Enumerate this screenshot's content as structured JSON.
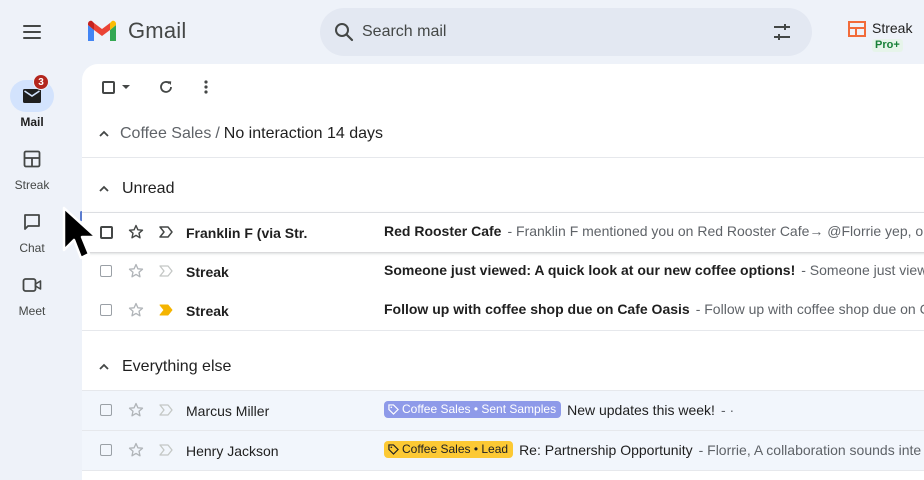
{
  "app": {
    "name": "Gmail"
  },
  "search": {
    "placeholder": "Search mail"
  },
  "streak": {
    "name": "Streak",
    "plan": "Pro+"
  },
  "rail": [
    {
      "label": "Mail",
      "icon": "mail-icon",
      "badge": "3",
      "active": true
    },
    {
      "label": "Streak",
      "icon": "streak-board-icon"
    },
    {
      "label": "Chat",
      "icon": "chat-icon"
    },
    {
      "label": "Meet",
      "icon": "meet-video-icon"
    }
  ],
  "breadcrumb": {
    "parent": "Coffee Sales",
    "separator": "/",
    "current": "No interaction 14 days"
  },
  "sections": {
    "unread": {
      "title": "Unread",
      "rows": [
        {
          "sender": "Franklin F (via Str.",
          "subject": "Red Rooster Cafe",
          "snippet": "- Franklin F mentioned you on Red Rooster Cafe→ @Florrie yep, one"
        },
        {
          "sender": "Streak",
          "subject": "Someone just viewed: A quick look at our new coffee options!",
          "snippet": "- Someone just view"
        },
        {
          "sender": "Streak",
          "subject": "Follow up with coffee shop due on Cafe Oasis",
          "snippet": "- Follow up with coffee shop due on C"
        }
      ]
    },
    "everything_else": {
      "title": "Everything else",
      "rows": [
        {
          "sender": "Marcus Miller",
          "tag": "Coffee Sales • Sent Samples",
          "subject": "New updates this week!",
          "snippet": "- ·"
        },
        {
          "sender": "Henry Jackson",
          "tag": "Coffee Sales • Lead",
          "subject": "Re: Partnership Opportunity",
          "snippet": "- Florrie, A collaboration sounds inte"
        }
      ]
    }
  },
  "colors": {
    "accent": "#0b57d0",
    "tag_purple": "#8e9ae9",
    "tag_yellow": "#fcc934",
    "badge": "#b3261e"
  }
}
